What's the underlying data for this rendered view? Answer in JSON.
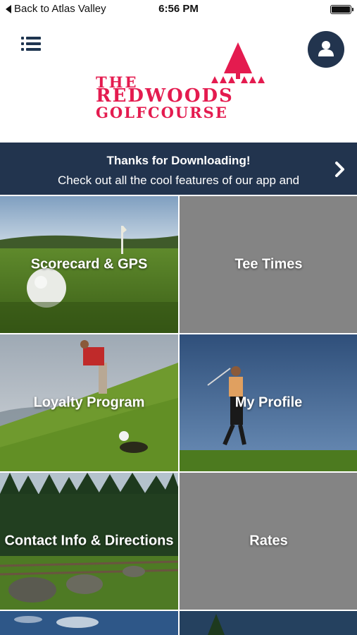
{
  "status_bar": {
    "back_label": "Back to Atlas Valley",
    "time": "6:56 PM"
  },
  "header": {
    "menu_icon": "list-icon",
    "profile_icon": "user-icon",
    "logo": {
      "line1": "THE",
      "line2": "REDWOODS",
      "line3": "GOLFCOURSE",
      "color": "#e41b4f"
    }
  },
  "banner": {
    "title": "Thanks for Downloading!",
    "subtitle": "Check out all the cool features of our app and",
    "background": "#22344e"
  },
  "tiles": [
    {
      "label": "Scorecard & GPS",
      "style": "photo-golf-ball"
    },
    {
      "label": "Tee Times",
      "style": "gray"
    },
    {
      "label": "Loyalty Program",
      "style": "photo-putting"
    },
    {
      "label": "My Profile",
      "style": "photo-swing"
    },
    {
      "label": "Contact Info & Directions",
      "style": "photo-forest"
    },
    {
      "label": "Rates",
      "style": "gray"
    }
  ]
}
